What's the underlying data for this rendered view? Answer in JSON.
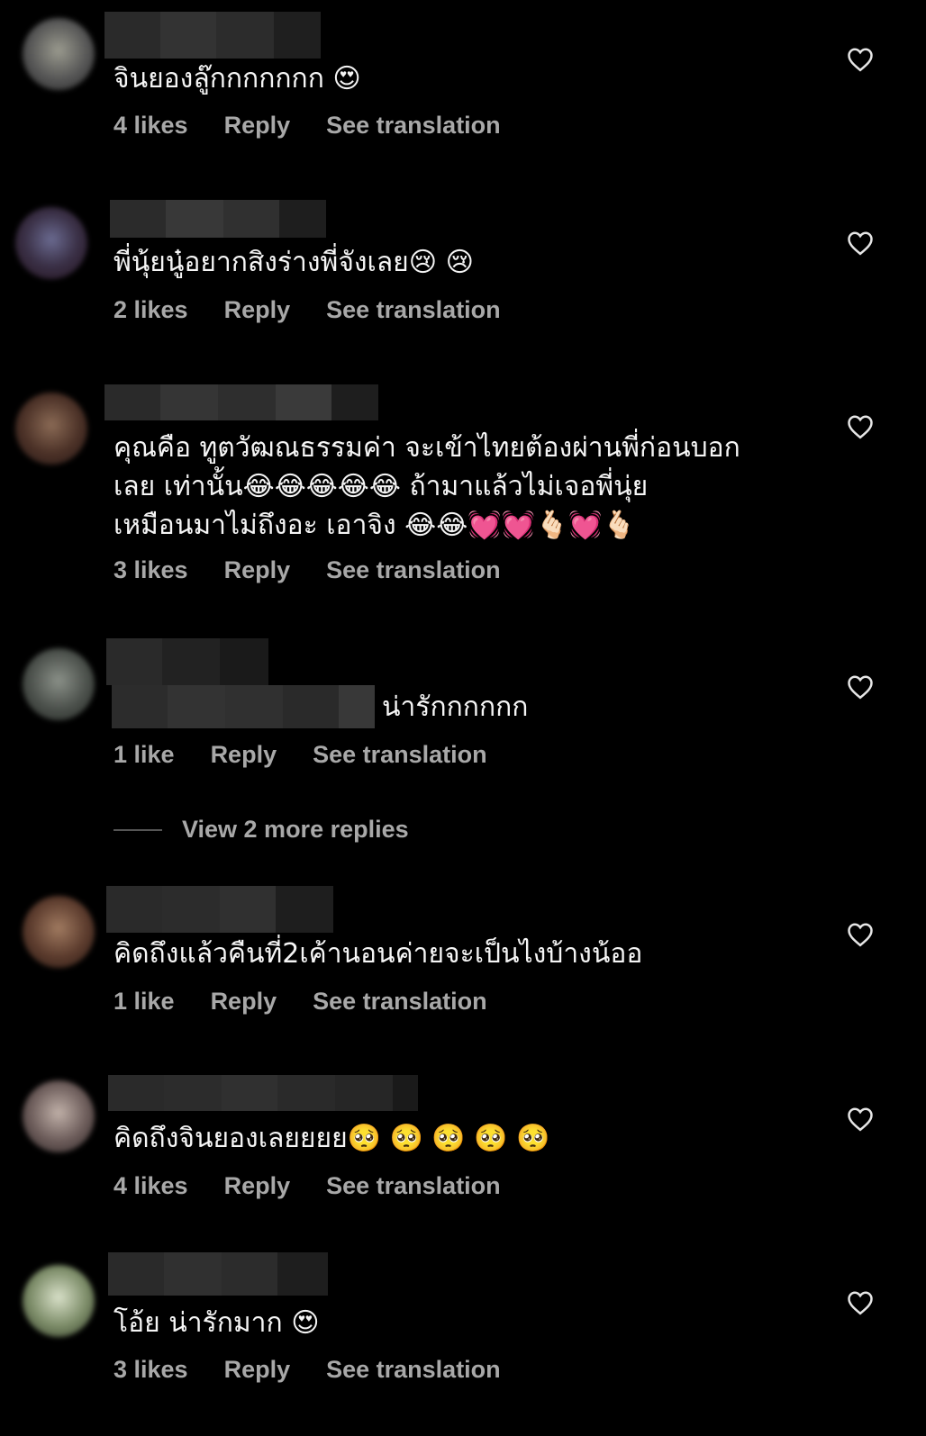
{
  "comments": [
    {
      "text": "จินยองลู๊กกกกกกก 😍",
      "likes": "4 likes",
      "reply": "Reply",
      "translate": "See translation"
    },
    {
      "text": "พี่นุ้ยนู๋อยากสิงร่างพี่จังเลย😢 😢",
      "likes": "2 likes",
      "reply": "Reply",
      "translate": "See translation"
    },
    {
      "text": "คุณคือ ทูตวัฒณธรรมค่า จะเข้าไทยต้องผ่านพี่ก่อนบอก\nเลย เท่านั้น😂😂😂😂😂 ถ้ามาแล้วไม่เจอพี่นุ่ย\nเหมือนมาไม่ถึงอะ เอาจิง 😂😂💓💓🫰🏻💓🫰🏻",
      "likes": "3 likes",
      "reply": "Reply",
      "translate": "See translation"
    },
    {
      "text": "น่ารักกกกกก",
      "likes": "1 like",
      "reply": "Reply",
      "translate": "See translation"
    },
    {
      "text": "คิดถึงแล้วคืนที่2เค้านอนค่ายจะเป็นไงบ้างน้ออ",
      "likes": "1 like",
      "reply": "Reply",
      "translate": "See translation"
    },
    {
      "text": "คิดถึงจินยองเลยยยย🥺 🥺 🥺 🥺 🥺",
      "likes": "4 likes",
      "reply": "Reply",
      "translate": "See translation"
    },
    {
      "text": "โอ้ย น่ารักมาก 😍",
      "likes": "3 likes",
      "reply": "Reply",
      "translate": "See translation"
    }
  ],
  "view_more_replies": "View 2 more replies",
  "icons": {
    "like": "heart-outline-icon"
  },
  "colors": {
    "background": "#000000",
    "meta": "#a8a8a8",
    "text": "#f5f5f5"
  }
}
